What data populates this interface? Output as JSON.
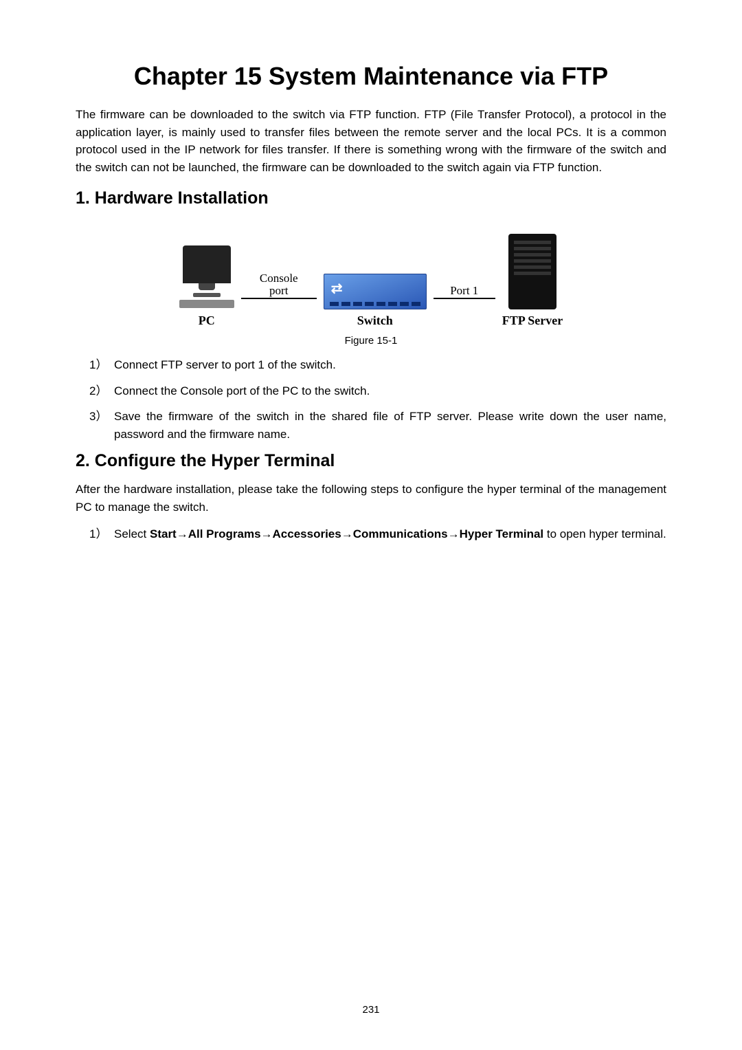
{
  "title": "Chapter 15  System Maintenance via FTP",
  "intro": "The firmware can be downloaded to the switch via FTP function. FTP (File Transfer Protocol), a protocol in the application layer, is mainly used to transfer files between the remote server and the local PCs. It is a common protocol used in the IP network for files transfer. If there is something wrong with the firmware of the switch and the switch can not be launched, the firmware can be downloaded to the switch again via FTP function.",
  "section1": {
    "heading": "1.  Hardware Installation",
    "diagram": {
      "pc_label": "PC",
      "console_label_line1": "Console",
      "console_label_line2": "port",
      "switch_label": "Switch",
      "port1_label": "Port 1",
      "server_label": "FTP Server"
    },
    "figure_caption": "Figure 15-1",
    "steps": [
      {
        "num": "1）",
        "text": "Connect FTP server to port 1 of the switch."
      },
      {
        "num": "2）",
        "text": "Connect the Console port of the PC to the switch."
      },
      {
        "num": "3）",
        "text": "Save the firmware of the switch in the shared file of FTP server. Please write down the user name, password and the firmware name."
      }
    ]
  },
  "section2": {
    "heading": "2.  Configure the Hyper Terminal",
    "intro": "After the hardware installation, please take the following steps to configure the hyper terminal of the management PC to manage the switch.",
    "step1": {
      "num": "1）",
      "prefix": "Select ",
      "path_start": "Start",
      "arrow": "→",
      "p1": "All Programs",
      "p2": "Accessories",
      "p3": "Communications",
      "p4": "Hyper Terminal",
      "suffix": " to open hyper terminal."
    }
  },
  "page_number": "231"
}
